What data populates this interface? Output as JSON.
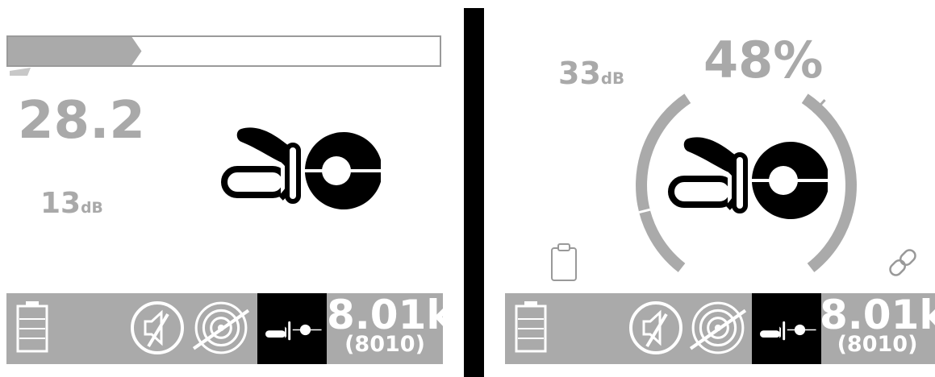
{
  "left_screen": {
    "progress": {
      "fraction": 0.31
    },
    "main_value": "28.2",
    "gain": {
      "value": "13",
      "unit": "dB"
    },
    "status_bar": {
      "mode_icon": "clamp-icon",
      "mute_icon": "speaker-muted-icon",
      "target_icon": "target-disabled-icon",
      "battery_icon": "battery-icon",
      "frequency": "8.01k",
      "frequency_exact": "(8010)"
    }
  },
  "right_screen": {
    "gain": {
      "value": "33",
      "unit": "dB"
    },
    "signal_strength": "48%",
    "left_arc_level": 0.35,
    "right_arc_level": 0.92,
    "clipboard_icon": "clipboard-icon",
    "link_icon": "link-icon",
    "status_bar": {
      "mode_icon": "clamp-icon",
      "mute_icon": "speaker-muted-icon",
      "target_icon": "target-disabled-icon",
      "battery_icon": "battery-icon",
      "frequency": "8.01k",
      "frequency_exact": "(8010)"
    }
  },
  "colors": {
    "foreground": "#000000",
    "dim_text": "#a9a9a9",
    "status_bar": "#aaaaaa",
    "background": "#ffffff"
  }
}
